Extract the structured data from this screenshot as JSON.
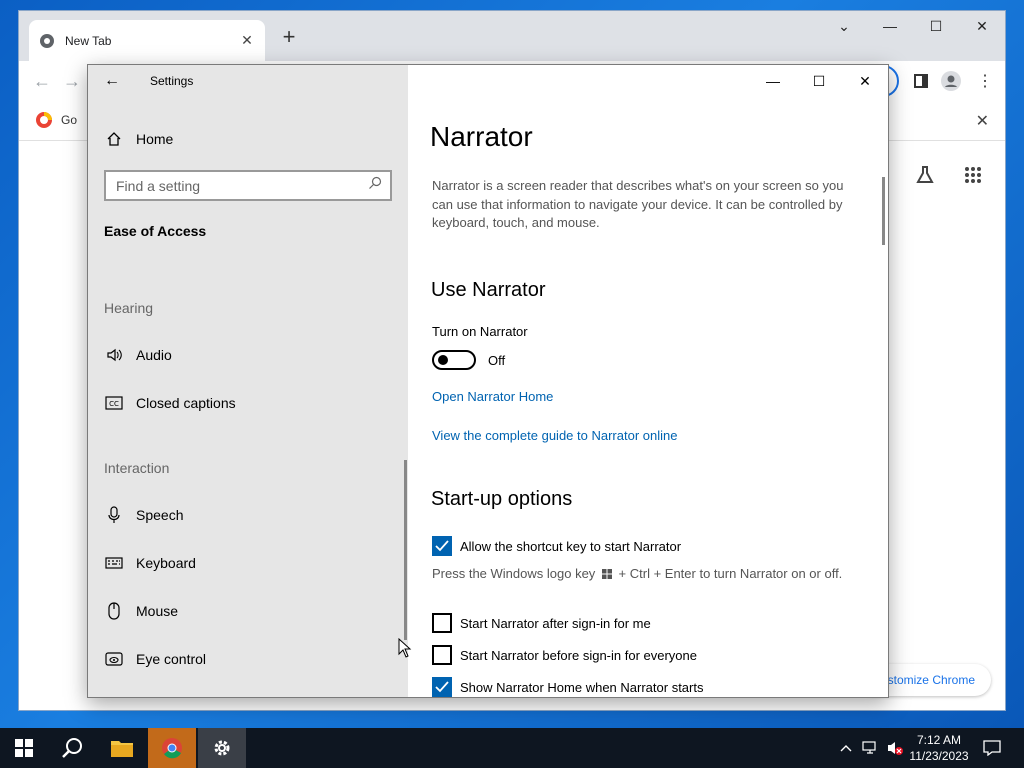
{
  "browser": {
    "tab_title": "New Tab",
    "bookmark_label": "Go",
    "customize_label": "Customize Chrome"
  },
  "settings": {
    "window_title": "Settings",
    "nav": {
      "home": "Home",
      "search_placeholder": "Find a setting",
      "category": "Ease of Access",
      "sections": [
        {
          "title": "Hearing",
          "items": [
            "Audio",
            "Closed captions"
          ]
        },
        {
          "title": "Interaction",
          "items": [
            "Speech",
            "Keyboard",
            "Mouse",
            "Eye control"
          ]
        }
      ]
    },
    "content": {
      "title": "Narrator",
      "description": "Narrator is a screen reader that describes what's on your screen so you can use that information to navigate your device. It can be controlled by keyboard, touch, and mouse.",
      "use_heading": "Use Narrator",
      "turn_on_label": "Turn on Narrator",
      "toggle_state": "Off",
      "link_home": "Open Narrator Home",
      "link_guide": "View the complete guide to Narrator online",
      "startup_heading": "Start-up options",
      "opt_shortcut": "Allow the shortcut key to start Narrator",
      "note_prefix": "Press the Windows logo key",
      "note_suffix": "+ Ctrl + Enter to turn Narrator on or off.",
      "opt_signin_me": "Start Narrator after sign-in for me",
      "opt_signin_all": "Start Narrator before sign-in for everyone",
      "opt_home": "Show Narrator Home when Narrator starts"
    }
  },
  "taskbar": {
    "time": "7:12 AM",
    "date": "11/23/2023"
  },
  "colors": {
    "accent": "#0063b1",
    "chrome_blue": "#1a73e8",
    "taskbar": "#0e1621"
  }
}
